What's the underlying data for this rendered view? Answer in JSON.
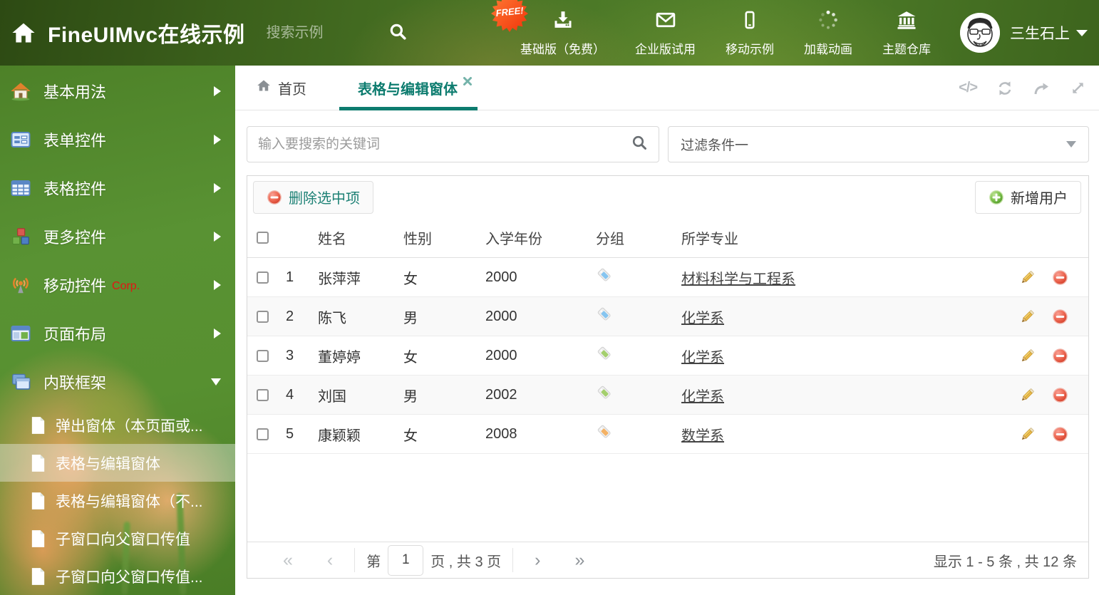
{
  "header": {
    "title": "FineUIMvc在线示例",
    "search_placeholder": "搜索示例",
    "free_badge": "FREE!",
    "nav": [
      {
        "label": "基础版（免费）",
        "icon": "download-icon"
      },
      {
        "label": "企业版试用",
        "icon": "envelope-icon"
      },
      {
        "label": "移动示例",
        "icon": "mobile-icon"
      },
      {
        "label": "加载动画",
        "icon": "spinner-icon"
      },
      {
        "label": "主题仓库",
        "icon": "bank-icon"
      }
    ],
    "user": {
      "name": "三生石上"
    }
  },
  "sidebar": {
    "items": [
      {
        "label": "基本用法"
      },
      {
        "label": "表单控件"
      },
      {
        "label": "表格控件"
      },
      {
        "label": "更多控件"
      },
      {
        "label": "移动控件",
        "badge": "Corp."
      },
      {
        "label": "页面布局"
      },
      {
        "label": "内联框架"
      }
    ],
    "subitems": [
      {
        "label": "弹出窗体（本页面或..."
      },
      {
        "label": "表格与编辑窗体",
        "selected": true
      },
      {
        "label": "表格与编辑窗体（不..."
      },
      {
        "label": "子窗口向父窗口传值"
      },
      {
        "label": "子窗口向父窗口传值..."
      }
    ]
  },
  "tabs": {
    "home": "首页",
    "active": "表格与编辑窗体"
  },
  "main": {
    "search_placeholder": "输入要搜索的关键词",
    "filter_value": "过滤条件一",
    "toolbar": {
      "delete_label": "删除选中项",
      "add_label": "新增用户"
    },
    "table": {
      "columns": {
        "name": "姓名",
        "gender": "性别",
        "year": "入学年份",
        "group": "分组",
        "major": "所学专业"
      },
      "rows": [
        {
          "index": "1",
          "name": "张萍萍",
          "gender": "女",
          "year": "2000",
          "tag_color": "#86c5f0",
          "major": "材料科学与工程系"
        },
        {
          "index": "2",
          "name": "陈飞",
          "gender": "男",
          "year": "2000",
          "tag_color": "#86c5f0",
          "major": "化学系"
        },
        {
          "index": "3",
          "name": "董婷婷",
          "gender": "女",
          "year": "2000",
          "tag_color": "#a4cf6d",
          "major": "化学系"
        },
        {
          "index": "4",
          "name": "刘国",
          "gender": "男",
          "year": "2002",
          "tag_color": "#a4cf6d",
          "major": "化学系"
        },
        {
          "index": "5",
          "name": "康颖颖",
          "gender": "女",
          "year": "2008",
          "tag_color": "#f4b265",
          "major": "数学系"
        }
      ]
    },
    "pagination": {
      "first": "«",
      "prev": "‹",
      "next": "›",
      "last": "»",
      "page_prefix": "第",
      "page_value": "1",
      "page_suffix": "页 , 共 3 页",
      "summary": "显示 1 - 5 条 , 共 12 条"
    }
  },
  "colors": {
    "accent_teal": "#0d7c6f",
    "header_green": "#4b7726",
    "corp_red": "#e41414"
  }
}
